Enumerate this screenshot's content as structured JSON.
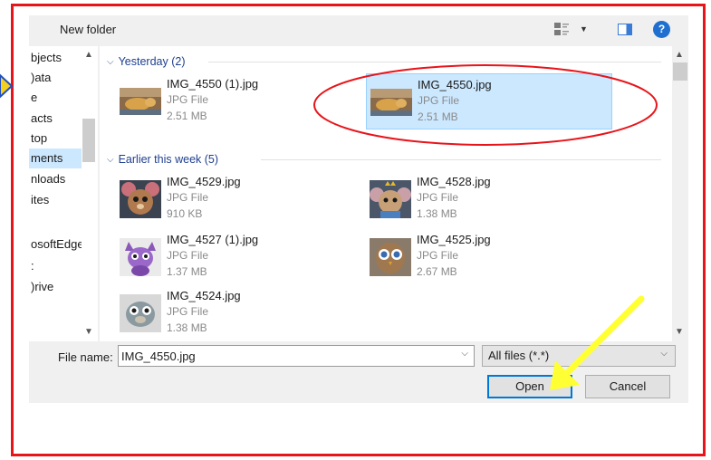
{
  "toolbar": {
    "new_folder_label": "New folder",
    "view_icon": "view-options-icon",
    "view_dropdown_icon": "chevron-down-icon",
    "preview_pane_icon": "preview-pane-icon",
    "help_label": "?"
  },
  "nav": {
    "items": [
      {
        "label": "bjects"
      },
      {
        "label": ")ata"
      },
      {
        "label": "e"
      },
      {
        "label": "acts"
      },
      {
        "label": "top"
      },
      {
        "label": "ments",
        "selected": true
      },
      {
        "label": "nloads"
      },
      {
        "label": "ites"
      },
      {
        "label": ""
      },
      {
        "label": "osoftEdgel"
      },
      {
        "label": ":"
      },
      {
        "label": ")rive"
      }
    ]
  },
  "groups": [
    {
      "label": "Yesterday (2)",
      "files": [
        {
          "name": "IMG_4550 (1).jpg",
          "type": "JPG File",
          "size": "2.51 MB",
          "thumb": "dog-photo"
        },
        {
          "name": "IMG_4550.jpg",
          "type": "JPG File",
          "size": "2.51 MB",
          "thumb": "dog-photo",
          "selected": true
        }
      ]
    },
    {
      "label": "Earlier this week (5)",
      "files": [
        {
          "name": "IMG_4529.jpg",
          "type": "JPG File",
          "size": "910 KB",
          "thumb": "mouse-toy"
        },
        {
          "name": "IMG_4528.jpg",
          "type": "JPG File",
          "size": "1.38 MB",
          "thumb": "mouse-toy-crown"
        },
        {
          "name": "IMG_4527 (1).jpg",
          "type": "JPG File",
          "size": "1.37 MB",
          "thumb": "purple-toy"
        },
        {
          "name": "IMG_4525.jpg",
          "type": "JPG File",
          "size": "2.67 MB",
          "thumb": "owl-toy"
        },
        {
          "name": "IMG_4524.jpg",
          "type": "JPG File",
          "size": "1.38 MB",
          "thumb": "otter-toy"
        }
      ]
    }
  ],
  "footer": {
    "filename_label": "File name:",
    "filename_value": "IMG_4550.jpg",
    "filter_value": "All files (*.*)",
    "open_label": "Open",
    "cancel_label": "Cancel"
  },
  "colors": {
    "border_red": "#e8141a",
    "annotation_yellow": "#ffff33",
    "selection_blue": "#cce8ff",
    "accent_blue": "#0078d7"
  }
}
